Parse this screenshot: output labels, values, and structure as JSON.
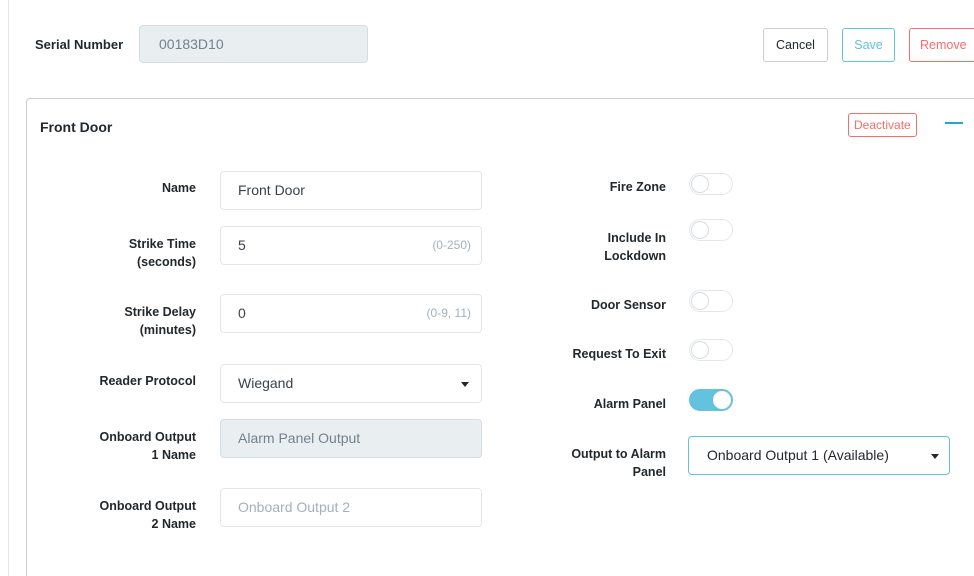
{
  "header": {
    "serial_label": "Serial Number",
    "serial_value": "00183D10",
    "cancel_label": "Cancel",
    "save_label": "Save",
    "remove_label": "Remove"
  },
  "door": {
    "title": "Front Door",
    "deactivate_label": "Deactivate",
    "fields": {
      "name": {
        "label": "Name",
        "value": "Front Door"
      },
      "strike_time": {
        "label_line1": "Strike Time",
        "label_line2": "(seconds)",
        "value": "5",
        "hint": "(0-250)"
      },
      "strike_delay": {
        "label_line1": "Strike Delay",
        "label_line2": "(minutes)",
        "value": "0",
        "hint": "(0-9, 11)"
      },
      "reader_protocol": {
        "label": "Reader Protocol",
        "value": "Wiegand"
      },
      "onboard_output_1": {
        "label_line1": "Onboard Output",
        "label_line2": "1 Name",
        "value": "Alarm Panel Output"
      },
      "onboard_output_2": {
        "label_line1": "Onboard Output",
        "label_line2": "2 Name",
        "placeholder": "Onboard Output 2"
      }
    },
    "toggles": {
      "fire_zone": {
        "label": "Fire Zone",
        "on": false
      },
      "include_in_lockdown": {
        "label_line1": "Include In",
        "label_line2": "Lockdown",
        "on": false
      },
      "door_sensor": {
        "label": "Door Sensor",
        "on": false
      },
      "request_to_exit": {
        "label": "Request To Exit",
        "on": false
      },
      "alarm_panel": {
        "label": "Alarm Panel",
        "on": true
      }
    },
    "output_to_alarm_panel": {
      "label_line1": "Output to Alarm",
      "label_line2": "Panel",
      "value": "Onboard Output 1 (Available)"
    }
  },
  "colors": {
    "accent": "#63c2de",
    "danger": "#f86c6b",
    "link": "#20a8d8"
  }
}
